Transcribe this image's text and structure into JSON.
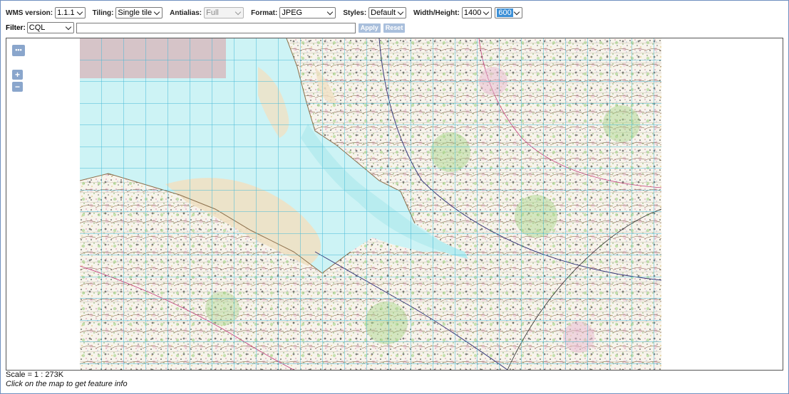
{
  "toolbar": {
    "wms_version": {
      "label": "WMS version:",
      "value": "1.1.1"
    },
    "tiling": {
      "label": "Tiling:",
      "value": "Single tile"
    },
    "antialias": {
      "label": "Antialias:",
      "value": "Full"
    },
    "format": {
      "label": "Format:",
      "value": "JPEG"
    },
    "styles": {
      "label": "Styles:",
      "value": "Default"
    },
    "width_height": {
      "label": "Width/Height:",
      "width": "1400",
      "height": "600"
    }
  },
  "filter": {
    "label": "Filter:",
    "type": "CQL",
    "value": "",
    "apply_label": "Apply",
    "reset_label": "Reset"
  },
  "map_controls": {
    "options_label": "•••",
    "zoom_in_label": "+",
    "zoom_out_label": "−"
  },
  "status": {
    "scale": "Scale = 1 : 273K",
    "hint": "Click on the map to get feature info"
  },
  "colors": {
    "grid": "#45b9d6",
    "water": "#cdf3f5",
    "nodata": "#d6c4c8",
    "sand": "#f0e1c4",
    "control": "#8aa6cc"
  }
}
